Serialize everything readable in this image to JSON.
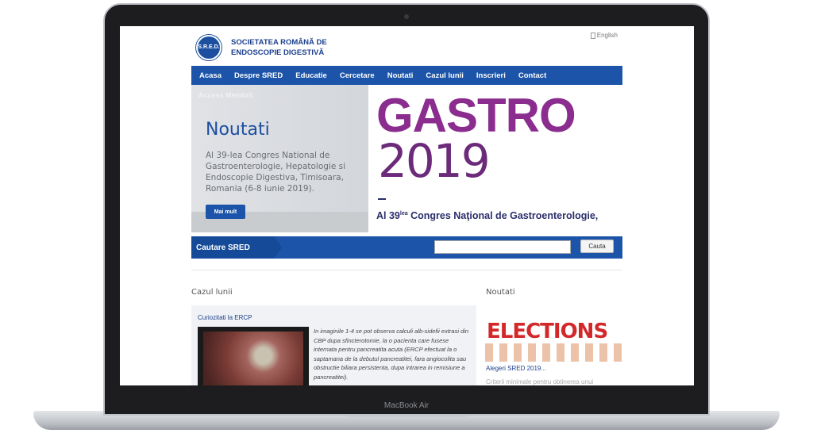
{
  "device": {
    "label": "MacBook Air"
  },
  "header": {
    "logo_seal_text": "S.R.E.D.",
    "logo_line1": "SOCIETATEA ROMÂNĂ DE",
    "logo_line2": "ENDOSCOPIE DIGESTIVĂ",
    "language_link": "English"
  },
  "nav": {
    "items": [
      {
        "label": "Acasa"
      },
      {
        "label": "Despre SRED"
      },
      {
        "label": "Educatie"
      },
      {
        "label": "Cercetare"
      },
      {
        "label": "Noutati"
      },
      {
        "label": "Cazul lunii"
      },
      {
        "label": "Inscrieri"
      },
      {
        "label": "Contact"
      }
    ]
  },
  "hero": {
    "access_label": "Access Membrii",
    "title": "Noutati",
    "text": "Al 39-lea Congres National de Gastroenterologie, Hepatologie si Endoscopie Digestiva, Timisoara, Romania (6-8 iunie 2019).",
    "button_label": "Mai mult",
    "banner_word": "GASTRO",
    "banner_year": "2019",
    "banner_caption_pre": "Al 39",
    "banner_caption_sup": "lea",
    "banner_caption_post": " Congres Naţional de Gastroenterologie,"
  },
  "search": {
    "label": "Cautare SRED",
    "input_value": "",
    "button_label": "Cauta"
  },
  "case": {
    "section_title": "Cazul lunii",
    "link": "Curiozitati la ERCP",
    "text": "In imaginile 1-4 se pot observa calculi alb-sidefii extrasi din CBP dupa sfincterotomie, la o pacienta care fusese internata pentru pancreatita acuta (ERCP efectuat la o saptamana de la debutul pancreatitei, fara angiocolita sau obstructie biliara persistenta, dupa intrarea in remisiune a pancreatitei)."
  },
  "news": {
    "section_title": "Noutati",
    "image_word": "ELECTIONS",
    "link": "Alegeri SRED 2019...",
    "subtext": "Criterii minimale pentru obtinerea unui"
  }
}
